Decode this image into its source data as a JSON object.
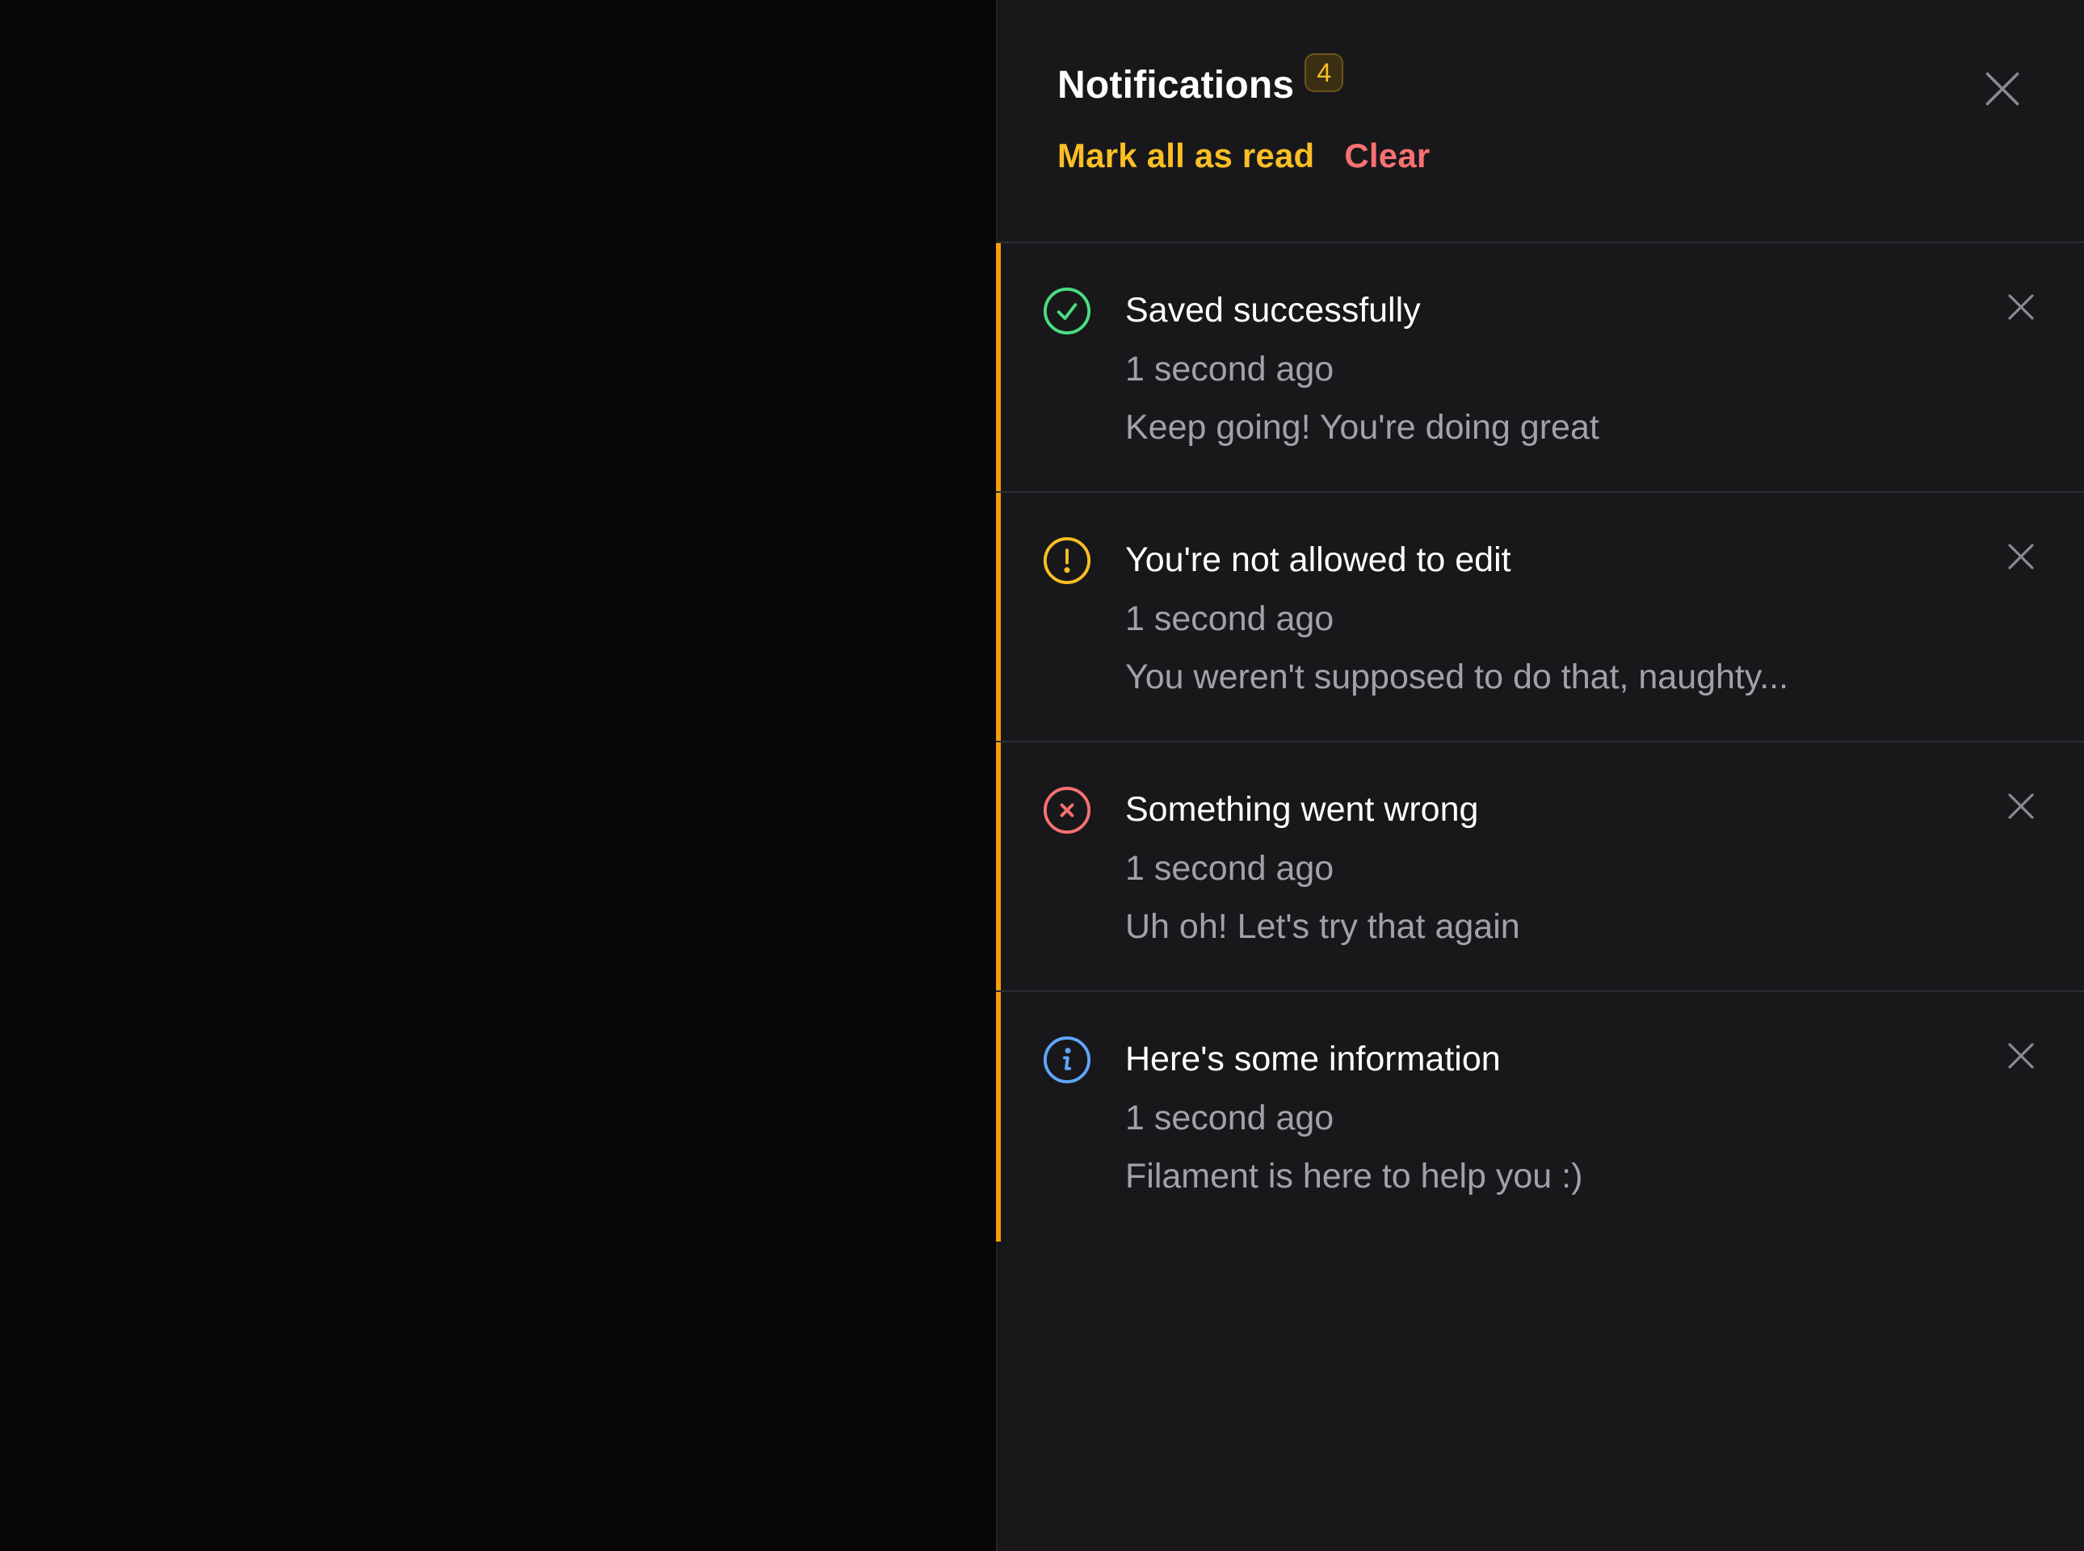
{
  "panel": {
    "title": "Notifications",
    "badge_count": "4",
    "mark_all_label": "Mark all as read",
    "clear_label": "Clear"
  },
  "colors": {
    "accent": "#f59e0b",
    "success": "#4ade80",
    "warning": "#fbbf24",
    "danger": "#f87171",
    "info": "#60a5fa"
  },
  "notifications": [
    {
      "icon": "check-circle-icon",
      "title": "Saved successfully",
      "time": "1 second ago",
      "body": "Keep going! You're doing great"
    },
    {
      "icon": "exclamation-circle-icon",
      "title": "You're not allowed to edit",
      "time": "1 second ago",
      "body": "You weren't supposed to do that, naughty..."
    },
    {
      "icon": "x-circle-icon",
      "title": "Something went wrong",
      "time": "1 second ago",
      "body": "Uh oh! Let's try that again"
    },
    {
      "icon": "information-circle-icon",
      "title": "Here's some information",
      "time": "1 second ago",
      "body": "Filament is here to help you :)"
    }
  ]
}
